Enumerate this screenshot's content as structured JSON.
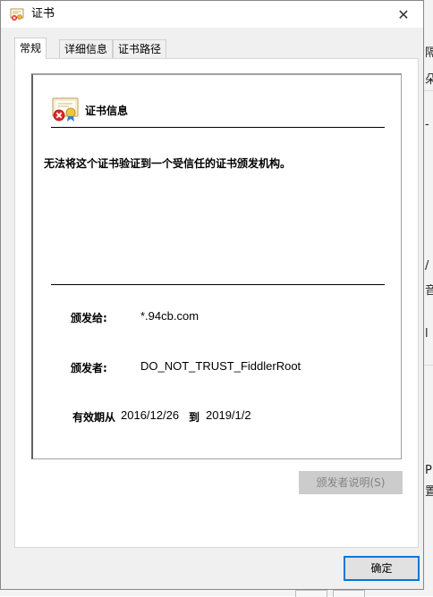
{
  "window": {
    "title": "证书",
    "close_glyph": "✕"
  },
  "tabs": [
    {
      "label": "常规",
      "active": true
    },
    {
      "label": "详细信息",
      "active": false
    },
    {
      "label": "证书路径",
      "active": false
    }
  ],
  "cert": {
    "heading": "证书信息",
    "icon": "certificate-error-icon",
    "warning": "无法将这个证书验证到一个受信任的证书颁发机构。",
    "issued_to_label": "颁发给:",
    "issued_to_value": "*.94cb.com",
    "issued_by_label": "颁发者:",
    "issued_by_value": "DO_NOT_TRUST_FiddlerRoot",
    "valid_from_label": "有效期从",
    "valid_from_value": "2016/12/26",
    "valid_to_label": "到",
    "valid_to_value": "2019/1/2"
  },
  "buttons": {
    "issuer_statement": "颁发者说明(S)",
    "ok": "确定"
  },
  "colors": {
    "accent": "#0078d7",
    "disabled_button": "#cccccc",
    "disabled_text": "#838383"
  }
}
